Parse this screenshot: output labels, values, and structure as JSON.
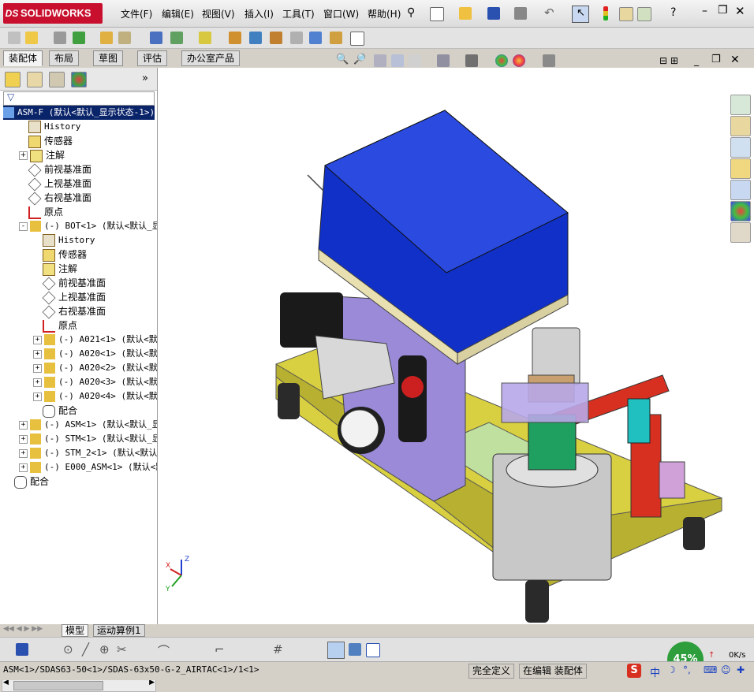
{
  "app": {
    "brand": "SOLIDWORKS",
    "ds_mark": "DS"
  },
  "menu": [
    "文件(F)",
    "编辑(E)",
    "视图(V)",
    "插入(I)",
    "工具(T)",
    "窗口(W)",
    "帮助(H)"
  ],
  "command_tabs": [
    "装配体",
    "布局",
    "草图",
    "评估",
    "办公室产品"
  ],
  "active_tab": "装配体",
  "tree": {
    "root": "ASM-F (默认<默认_显示状态-1>)",
    "items": [
      {
        "label": "History",
        "indent": 1,
        "icon": "history-icon",
        "expander": ""
      },
      {
        "label": "传感器",
        "indent": 1,
        "icon": "sensor-icon",
        "expander": ""
      },
      {
        "label": "注解",
        "indent": 1,
        "icon": "annotation-icon",
        "expander": "+"
      },
      {
        "label": "前视基准面",
        "indent": 1,
        "icon": "plane-icon",
        "expander": ""
      },
      {
        "label": "上视基准面",
        "indent": 1,
        "icon": "plane-icon",
        "expander": ""
      },
      {
        "label": "右视基准面",
        "indent": 1,
        "icon": "plane-icon",
        "expander": ""
      },
      {
        "label": "原点",
        "indent": 1,
        "icon": "origin-icon",
        "expander": ""
      },
      {
        "label": "(-) BOT<1> (默认<默认_显示",
        "indent": 1,
        "icon": "subassembly-icon",
        "expander": "-"
      },
      {
        "label": "History",
        "indent": 2,
        "icon": "history-icon",
        "expander": ""
      },
      {
        "label": "传感器",
        "indent": 2,
        "icon": "sensor-icon",
        "expander": ""
      },
      {
        "label": "注解",
        "indent": 2,
        "icon": "annotation-icon",
        "expander": ""
      },
      {
        "label": "前视基准面",
        "indent": 2,
        "icon": "plane-icon",
        "expander": ""
      },
      {
        "label": "上视基准面",
        "indent": 2,
        "icon": "plane-icon",
        "expander": ""
      },
      {
        "label": "右视基准面",
        "indent": 2,
        "icon": "plane-icon",
        "expander": ""
      },
      {
        "label": "原点",
        "indent": 2,
        "icon": "origin-icon",
        "expander": ""
      },
      {
        "label": "(-) A021<1> (默认<默认",
        "indent": 2,
        "icon": "subassembly-icon",
        "expander": "+"
      },
      {
        "label": "(-) A020<1> (默认<默认",
        "indent": 2,
        "icon": "subassembly-icon",
        "expander": "+"
      },
      {
        "label": "(-) A020<2> (默认<默认",
        "indent": 2,
        "icon": "subassembly-icon",
        "expander": "+"
      },
      {
        "label": "(-) A020<3> (默认<默认",
        "indent": 2,
        "icon": "subassembly-icon",
        "expander": "+"
      },
      {
        "label": "(-) A020<4> (默认<默认",
        "indent": 2,
        "icon": "subassembly-icon",
        "expander": "+"
      },
      {
        "label": "配合",
        "indent": 2,
        "icon": "mates-icon",
        "expander": ""
      },
      {
        "label": "(-) ASM<1> (默认<默认_显示",
        "indent": 1,
        "icon": "subassembly-icon",
        "expander": "+"
      },
      {
        "label": "(-) STM<1> (默认<默认_显示",
        "indent": 1,
        "icon": "subassembly-icon",
        "expander": "+"
      },
      {
        "label": "(-) STM_2<1> (默认<默认_显",
        "indent": 1,
        "icon": "subassembly-icon",
        "expander": "+"
      },
      {
        "label": "(-) E000_ASM<1> (默认<默认",
        "indent": 1,
        "icon": "subassembly-icon",
        "expander": "+"
      },
      {
        "label": "配合",
        "indent": 0,
        "icon": "mates-icon",
        "expander": ""
      }
    ]
  },
  "bottom_tabs": [
    "模型",
    "运动算例1"
  ],
  "status": {
    "path": "ASM<1>/SDAS63-50<1>/SDAS-63x50-G-2_AIRTAC<1>/1<1>",
    "definition": "完全定义",
    "mode": "在编辑 装配体"
  },
  "net_widget": {
    "percent": "45%",
    "rate": "0K/s"
  },
  "ime": {
    "label": "中"
  },
  "triad": {
    "x": "X",
    "y": "Y",
    "z": "Z"
  },
  "colors": {
    "brand": "#c8102e",
    "selection": "#0a246a",
    "box_blue": "#1030c8",
    "base_yellow": "#d8d040"
  }
}
